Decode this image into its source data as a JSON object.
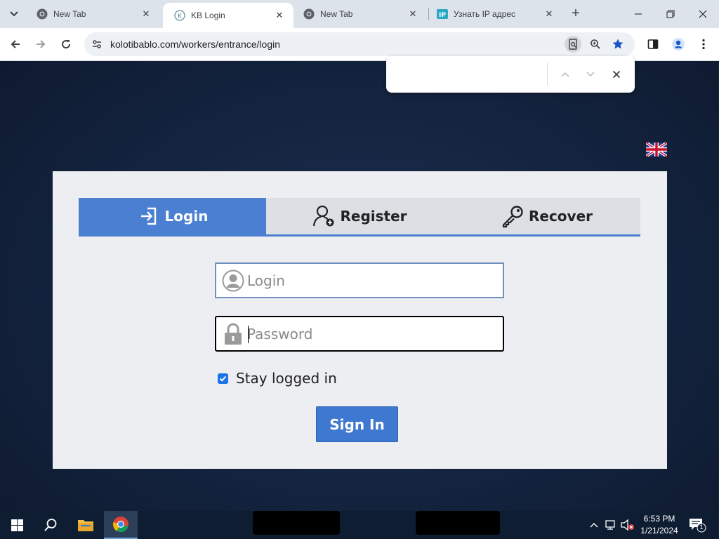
{
  "browser": {
    "tabs": [
      {
        "title": "New Tab",
        "icon": "chrome-icon",
        "active": false
      },
      {
        "title": "KB Login",
        "icon": "kb-favicon",
        "active": true
      },
      {
        "title": "New Tab",
        "icon": "chrome-icon",
        "active": false
      },
      {
        "title": "Узнать IP адрес",
        "icon": "ip-favicon",
        "active": false
      }
    ],
    "url": "kolotibablo.com/workers/entrance/login",
    "find_value": ""
  },
  "login_page": {
    "tabs": [
      {
        "label": "Login",
        "icon": "login-arrow-icon",
        "active": true
      },
      {
        "label": "Register",
        "icon": "add-user-icon",
        "active": false
      },
      {
        "label": "Recover",
        "icon": "key-icon",
        "active": false
      }
    ],
    "login_placeholder": "Login",
    "login_value": "",
    "password_placeholder": "Password",
    "password_value": "",
    "stay_logged_in_label": "Stay logged in",
    "stay_logged_in_checked": true,
    "signin_label": "Sign In",
    "language_flag": "uk-flag"
  },
  "taskbar": {
    "time": "6:53 PM",
    "date": "1/21/2024",
    "notification_count": "1"
  },
  "colors": {
    "accent": "#4a7fd2",
    "button": "#3e78d0"
  }
}
